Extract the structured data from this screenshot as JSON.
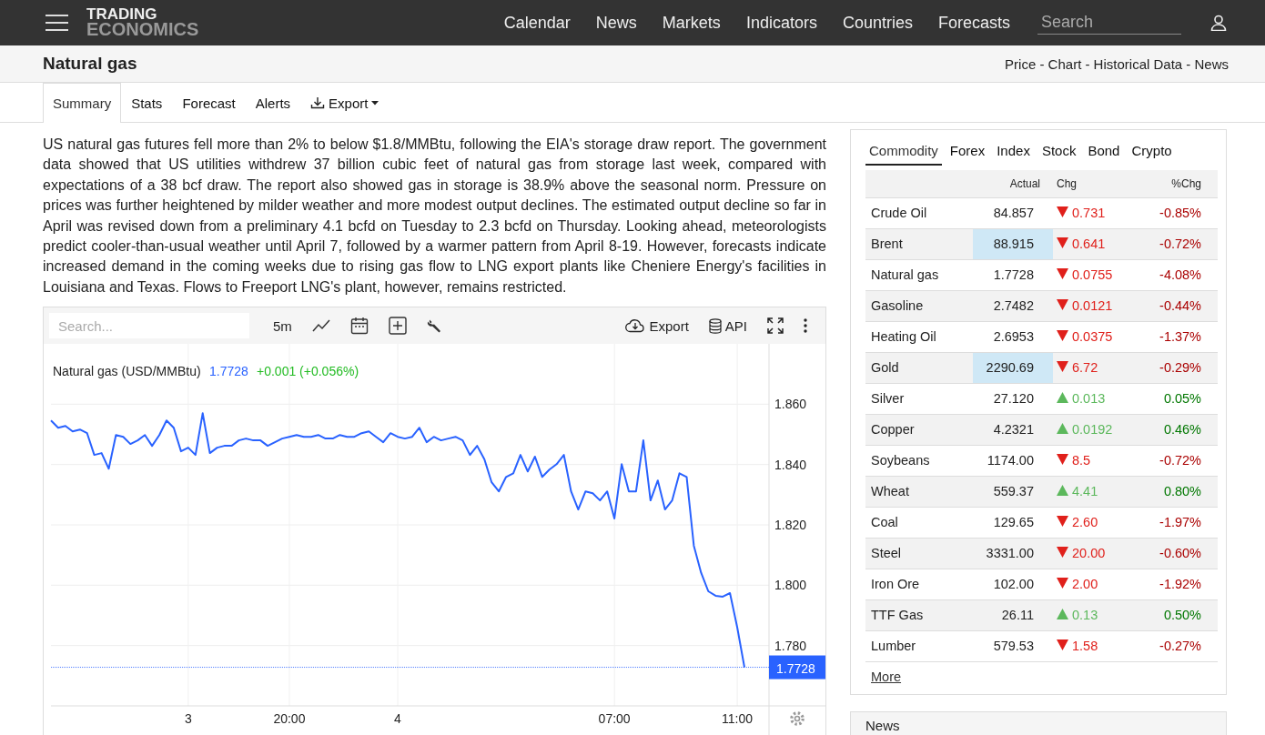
{
  "header": {
    "logo_top": "TRADING",
    "logo_bottom": "ECONOMICS",
    "nav": [
      "Calendar",
      "News",
      "Markets",
      "Indicators",
      "Countries",
      "Forecasts"
    ],
    "search": {
      "placeholder": "Search"
    }
  },
  "title_bar": {
    "title": "Natural gas",
    "links": "Price - Chart - Historical Data - News"
  },
  "tabs": [
    {
      "label": "Summary",
      "selected": true,
      "kind": "tab"
    },
    {
      "label": "Stats",
      "selected": false,
      "kind": "tab"
    },
    {
      "label": "Forecast",
      "selected": false,
      "kind": "tab"
    },
    {
      "label": "Alerts",
      "selected": false,
      "kind": "tab"
    },
    {
      "label": "Export",
      "selected": false,
      "kind": "dropdown"
    }
  ],
  "summary": "US natural gas futures fell more than 2% to below $1.8/MMBtu, following the EIA's storage draw report. The government data showed that US utilities withdrew 37 billion cubic feet of natural gas from storage last week, compared with expectations of a 38 bcf draw. The report also showed gas in storage is 38.9% above the seasonal norm. Pressure on prices was further heightened by milder weather and more modest output declines. The estimated output decline so far in April was revised down from a preliminary 4.1 bcfd on Tuesday to 2.3 bcfd on Thursday. Looking ahead, meteorologists predict cooler-than-usual weather until April 7, followed by a warmer pattern from April 8-19. However, forecasts indicate increased demand in the coming weeks due to rising gas flow to LNG export plants like Cheniere Energy's facilities in Louisiana and Texas. Flows to Freeport LNG's plant, however, remains restricted.",
  "chart": {
    "search": {
      "placeholder": "Search..."
    },
    "interval": "5m",
    "export": "Export",
    "api": "API",
    "legend": {
      "price": "1.7728",
      "change": "+0.001 (+0.056%)"
    },
    "last_price": "1.7728",
    "chart_data": {
      "type": "line",
      "grid": true,
      "ylim": [
        1.76,
        1.88
      ],
      "categories": [
        null,
        null,
        null,
        null,
        null,
        null,
        null,
        null,
        null,
        null,
        null,
        null,
        null,
        null,
        null,
        null,
        null,
        null,
        null,
        "3",
        null,
        null,
        null,
        null,
        null,
        null,
        null,
        null,
        null,
        null,
        null,
        null,
        null,
        "20:00",
        null,
        null,
        null,
        null,
        null,
        null,
        null,
        null,
        null,
        null,
        null,
        null,
        null,
        null,
        "4",
        null,
        null,
        null,
        null,
        null,
        null,
        null,
        null,
        null,
        null,
        null,
        null,
        null,
        null,
        null,
        null,
        null,
        null,
        null,
        null,
        null,
        null,
        null,
        null,
        null,
        null,
        null,
        null,
        null,
        "07:00",
        null,
        null,
        null,
        null,
        null,
        null,
        null,
        null,
        null,
        null,
        null,
        null,
        null,
        null,
        null,
        null,
        "11:00",
        null
      ],
      "yticks": [
        {
          "value": 1.78,
          "label": "1.780"
        },
        {
          "value": 1.8,
          "label": "1.800"
        },
        {
          "value": 1.82,
          "label": "1.820"
        },
        {
          "value": 1.84,
          "label": "1.840"
        },
        {
          "value": 1.86,
          "label": "1.860"
        }
      ],
      "ref_lines": [
        {
          "axis": "y",
          "value": 1.7728,
          "color": "#2962ff"
        }
      ],
      "series": [
        {
          "name": "Natural gas (USD/MMBtu)",
          "color": "#2962ff",
          "values": [
            1.8546,
            1.8522,
            1.8528,
            1.851,
            1.8516,
            1.8504,
            1.8432,
            1.8438,
            1.8386,
            1.8498,
            1.8492,
            1.8468,
            1.848,
            1.8498,
            1.8462,
            1.8498,
            1.8546,
            1.8522,
            1.8444,
            1.8456,
            1.8432,
            1.857,
            1.8438,
            1.8456,
            1.8462,
            1.8462,
            1.848,
            1.8486,
            1.848,
            1.848,
            1.8462,
            1.8474,
            1.8486,
            1.8492,
            1.8498,
            1.8492,
            1.8492,
            1.8498,
            1.8486,
            1.8486,
            1.8498,
            1.8492,
            1.8492,
            1.8504,
            1.851,
            1.8492,
            1.8474,
            1.8504,
            1.8492,
            1.8486,
            1.8492,
            1.8522,
            1.8474,
            1.8492,
            1.848,
            1.8486,
            1.8492,
            1.848,
            1.8432,
            1.8462,
            1.8417,
            1.8341,
            1.8311,
            1.8359,
            1.8371,
            1.8432,
            1.8377,
            1.8426,
            1.8359,
            1.8383,
            1.8401,
            1.8432,
            1.8311,
            1.8251,
            1.8311,
            1.8305,
            1.8281,
            1.8311,
            1.8221,
            1.8401,
            1.8311,
            1.8311,
            1.848,
            1.8281,
            1.8347,
            1.8251,
            1.8281,
            1.8371,
            1.8359,
            1.8131,
            1.8041,
            1.798,
            1.7965,
            1.7962,
            1.7974,
            1.786,
            1.7728
          ]
        }
      ]
    }
  },
  "markets": {
    "tabs": [
      {
        "label": "Commodity",
        "selected": true
      },
      {
        "label": "Forex",
        "selected": false
      },
      {
        "label": "Index",
        "selected": false
      },
      {
        "label": "Stock",
        "selected": false
      },
      {
        "label": "Bond",
        "selected": false
      },
      {
        "label": "Crypto",
        "selected": false
      }
    ],
    "columns": [
      "Actual",
      "Chg",
      "%Chg"
    ],
    "rows": [
      {
        "name": "Crude Oil",
        "actual": "84.857",
        "chg": "0.731",
        "pct": "-0.85%",
        "rising": false,
        "highlighted": false
      },
      {
        "name": "Brent",
        "actual": "88.915",
        "chg": "0.641",
        "pct": "-0.72%",
        "rising": false,
        "highlighted": true
      },
      {
        "name": "Natural gas",
        "actual": "1.7728",
        "chg": "0.0755",
        "pct": "-4.08%",
        "rising": false,
        "highlighted": false
      },
      {
        "name": "Gasoline",
        "actual": "2.7482",
        "chg": "0.0121",
        "pct": "-0.44%",
        "rising": false,
        "highlighted": false
      },
      {
        "name": "Heating Oil",
        "actual": "2.6953",
        "chg": "0.0375",
        "pct": "-1.37%",
        "rising": false,
        "highlighted": false
      },
      {
        "name": "Gold",
        "actual": "2290.69",
        "chg": "6.72",
        "pct": "-0.29%",
        "rising": false,
        "highlighted": true
      },
      {
        "name": "Silver",
        "actual": "27.120",
        "chg": "0.013",
        "pct": "0.05%",
        "rising": true,
        "highlighted": false
      },
      {
        "name": "Copper",
        "actual": "4.2321",
        "chg": "0.0192",
        "pct": "0.46%",
        "rising": true,
        "highlighted": false
      },
      {
        "name": "Soybeans",
        "actual": "1174.00",
        "chg": "8.5",
        "pct": "-0.72%",
        "rising": false,
        "highlighted": false
      },
      {
        "name": "Wheat",
        "actual": "559.37",
        "chg": "4.41",
        "pct": "0.80%",
        "rising": true,
        "highlighted": false
      },
      {
        "name": "Coal",
        "actual": "129.65",
        "chg": "2.60",
        "pct": "-1.97%",
        "rising": false,
        "highlighted": false
      },
      {
        "name": "Steel",
        "actual": "3331.00",
        "chg": "20.00",
        "pct": "-0.60%",
        "rising": false,
        "highlighted": false
      },
      {
        "name": "Iron Ore",
        "actual": "102.00",
        "chg": "2.00",
        "pct": "-1.92%",
        "rising": false,
        "highlighted": false
      },
      {
        "name": "TTF Gas",
        "actual": "26.11",
        "chg": "0.13",
        "pct": "0.50%",
        "rising": true,
        "highlighted": false
      },
      {
        "name": "Lumber",
        "actual": "579.53",
        "chg": "1.58",
        "pct": "-0.27%",
        "rising": false,
        "highlighted": false
      }
    ],
    "more": "More"
  },
  "news": {
    "title": "News"
  }
}
